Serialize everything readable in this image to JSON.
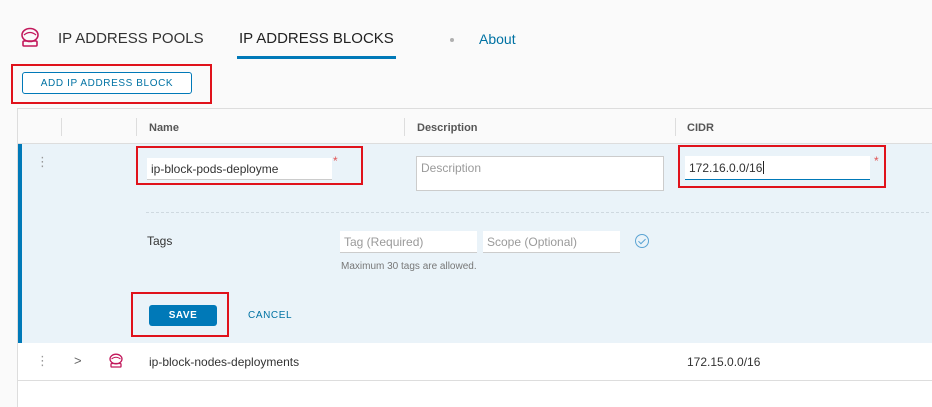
{
  "tabs": {
    "pools": "IP ADDRESS POOLS",
    "blocks": "IP ADDRESS BLOCKS",
    "about": "About"
  },
  "toolbar": {
    "add_label": "ADD IP ADDRESS BLOCK"
  },
  "grid": {
    "headers": {
      "name": "Name",
      "description": "Description",
      "cidr": "CIDR"
    },
    "edit_row": {
      "name_value": "ip-block-pods-deployme",
      "description_placeholder": "Description",
      "cidr_value": "172.16.0.0/16",
      "required_mark": "*",
      "tags_label": "Tags",
      "tag_placeholder": "Tag (Required)",
      "scope_placeholder": "Scope (Optional)",
      "tags_note": "Maximum 30 tags are allowed.",
      "save_label": "SAVE",
      "cancel_label": "CANCEL"
    },
    "rows": [
      {
        "name": "ip-block-nodes-deployments",
        "cidr": "172.15.0.0/16"
      }
    ]
  },
  "icons": {
    "tab_icon": "ip-pool-icon",
    "row_icon": "ip-block-icon",
    "kebab": "kebab-menu-icon",
    "chevron": "chevron-right-icon",
    "tag_check": "check-circle-icon"
  },
  "colors": {
    "accent": "#0079b8",
    "highlight": "#e0121b",
    "required": "#e05555"
  }
}
